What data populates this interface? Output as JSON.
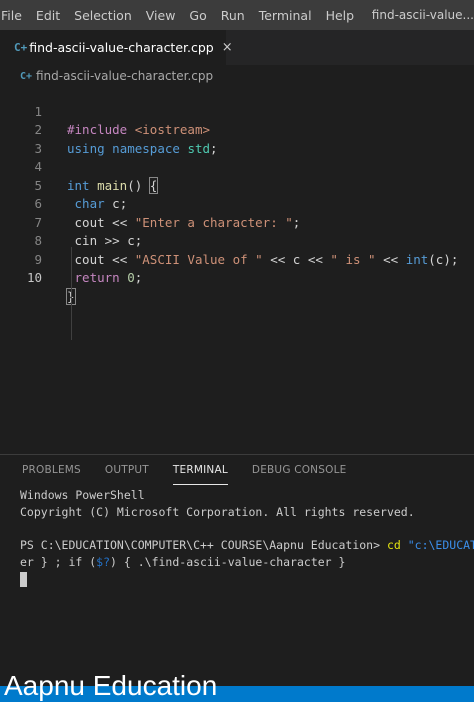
{
  "menubar": {
    "items": [
      "File",
      "Edit",
      "Selection",
      "View",
      "Go",
      "Run",
      "Terminal",
      "Help"
    ],
    "window_title": "find-ascii-value..."
  },
  "tab": {
    "label": "find-ascii-value-character.cpp",
    "icon": "cpp-file-icon",
    "icon_text": "C+",
    "close": "×"
  },
  "breadcrumb": {
    "label": "find-ascii-value-character.cpp",
    "icon_text": "C+"
  },
  "editor": {
    "line_numbers": [
      "1",
      "2",
      "3",
      "4",
      "5",
      "6",
      "7",
      "8",
      "9",
      "10"
    ],
    "active_line": "10",
    "code": {
      "l1_directive": "#include",
      "l1_header": "<iostream>",
      "l2_using": "using",
      "l2_namespace": "namespace",
      "l2_std": "std",
      "l2_semi": ";",
      "l4_int": "int",
      "l4_main": "main",
      "l4_parens": "() ",
      "l4_brace": "{",
      "l5_char": "char",
      "l5_rest": " c;",
      "l6_cout": "cout",
      "l6_op": " << ",
      "l6_str": "\"Enter a character: \"",
      "l6_semi": ";",
      "l7_cin": "cin",
      "l7_rest": " >> c;",
      "l8_cout": "cout",
      "l8_op1": " << ",
      "l8_str1": "\"ASCII Value of \"",
      "l8_op2": " << c << ",
      "l8_str2": "\" is \"",
      "l8_op3": " << ",
      "l8_int": "int",
      "l8_rest": "(c);",
      "l9_return": "return",
      "l9_num": "0",
      "l9_semi": ";",
      "l10_brace": "}"
    }
  },
  "panel": {
    "tabs": [
      "PROBLEMS",
      "OUTPUT",
      "TERMINAL",
      "DEBUG CONSOLE"
    ],
    "active_tab": "TERMINAL"
  },
  "terminal": {
    "line1": "Windows PowerShell",
    "line2": "Copyright (C) Microsoft Corporation. All rights reserved.",
    "prompt": "PS C:\\EDUCATION\\COMPUTER\\C++ COURSE\\Aapnu Education> ",
    "cmd": "cd",
    "cmd_arg": " \"c:\\EDUCATI",
    "line4_a": "er } ; if (",
    "line4_var": "$?",
    "line4_b": ") { .\\find-ascii-value-character }"
  },
  "watermark": {
    "text": "Aapnu Education"
  },
  "colors": {
    "accent": "#007acc",
    "editor_bg": "#1e1e1e",
    "menubar_bg": "#3c3c3c",
    "keyword": "#569cd6",
    "string": "#ce9178",
    "directive": "#c586c0"
  }
}
